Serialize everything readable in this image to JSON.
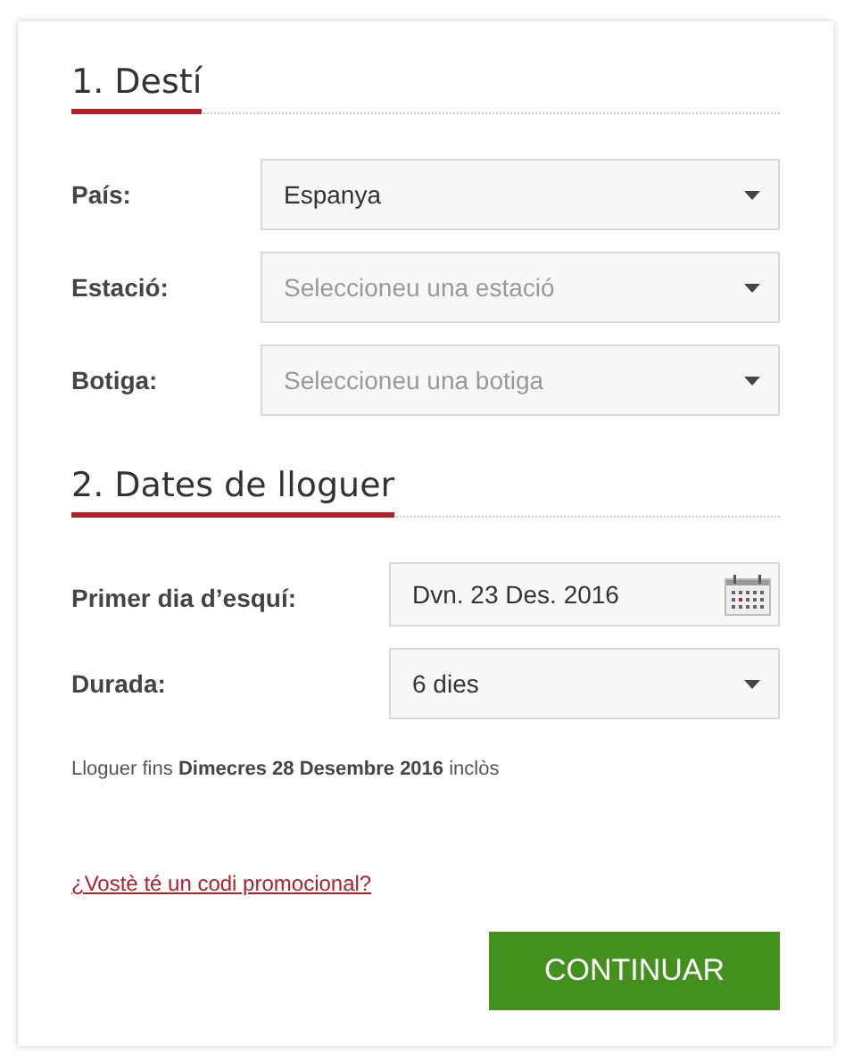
{
  "sections": [
    {
      "title": "1. Destí",
      "fields": [
        {
          "kind": "select",
          "label": "País:",
          "value": "Espanya"
        },
        {
          "kind": "select",
          "label": "Estació:",
          "placeholder": "Seleccioneu una estació"
        },
        {
          "kind": "select",
          "label": "Botiga:",
          "placeholder": "Seleccioneu una botiga"
        }
      ]
    },
    {
      "title": "2. Dates de lloguer",
      "fields": [
        {
          "kind": "date",
          "label": "Primer dia d’esquí:",
          "value": "Dvn. 23 Des. 2016"
        },
        {
          "kind": "select",
          "label": "Durada:",
          "value": "6 dies"
        }
      ]
    }
  ],
  "note": "Lloguer fins **Dimecres 28 Desembre 2016** inclòs",
  "promo_link": "¿Vostè té un codi promocional?",
  "button": "CONTINUAR"
}
